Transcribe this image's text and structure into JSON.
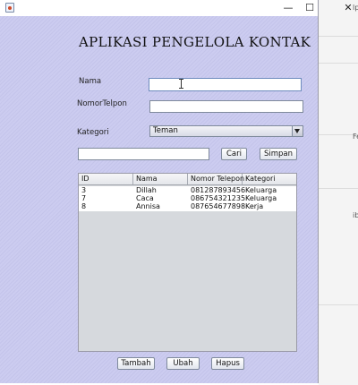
{
  "window": {
    "title": "",
    "controls": {
      "minimize": "—",
      "maximize": "☐",
      "close": "✕"
    }
  },
  "heading": "APLIKASI PENGELOLA KONTAK",
  "form": {
    "nama_label": "Nama",
    "nama_value": "",
    "telp_label": "NomorTelpon",
    "telp_value": "",
    "kategori_label": "Kategori",
    "kategori_selected": "Teman"
  },
  "search": {
    "value": "",
    "cari_label": "Cari",
    "simpan_label": "Simpan"
  },
  "table": {
    "columns": [
      "ID",
      "Nama",
      "Nomor Telepon",
      "Kategori"
    ],
    "rows": [
      [
        "3",
        "Dillah",
        "081287893456",
        "Keluarga"
      ],
      [
        "7",
        "Caca",
        "086754321235",
        "Keluarga"
      ],
      [
        "8",
        "Annisa",
        "087654677898",
        "Kerja"
      ]
    ]
  },
  "actions": {
    "tambah": "Tambah",
    "ubah": "Ubah",
    "hapus": "Hapus"
  },
  "background_fragments": [
    "lp",
    "Fe",
    "ib"
  ]
}
